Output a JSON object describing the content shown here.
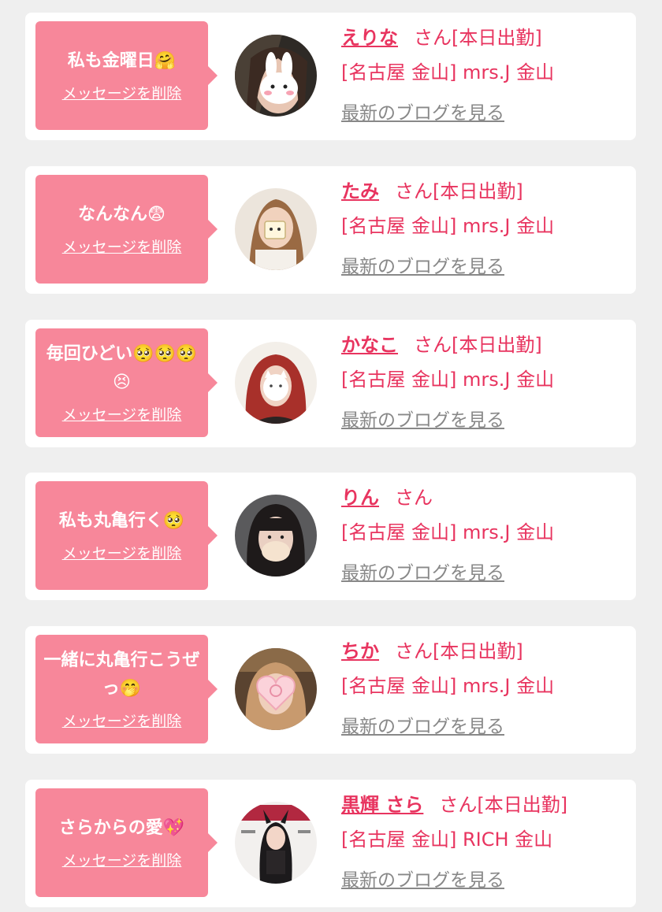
{
  "ui": {
    "delete_label": "メッセージを削除",
    "blog_label": "最新のブログを見る"
  },
  "colors": {
    "page_bg": "#efefef",
    "bubble_pink": "#f7879a",
    "accent_text": "#e8345f",
    "muted_text": "#888888"
  },
  "cards": [
    {
      "message": "私も金曜日🤗",
      "name": "えりな",
      "suffix": "さん[本日出勤]",
      "shop": "[名古屋 金山] mrs.J 金山",
      "avatar_icon": "girl-photo-rabbit-sticker-icon"
    },
    {
      "message": "なんなん😨",
      "name": "たみ",
      "suffix": "さん[本日出勤]",
      "shop": "[名古屋 金山] mrs.J 金山",
      "avatar_icon": "girl-photo-cube-sticker-icon"
    },
    {
      "message": "毎回ひどい🥺🥺🥺😣",
      "name": "かなこ",
      "suffix": "さん[本日出勤]",
      "shop": "[名古屋 金山] mrs.J 金山",
      "avatar_icon": "girl-photo-cat-sticker-icon"
    },
    {
      "message": "私も丸亀行く🥺",
      "name": "りん",
      "suffix": "さん",
      "shop": "[名古屋 金山] mrs.J 金山",
      "avatar_icon": "girl-photo-mask-icon"
    },
    {
      "message": "一緒に丸亀行こうぜっ🤭",
      "name": "ちか",
      "suffix": "さん[本日出勤]",
      "shop": "[名古屋 金山] mrs.J 金山",
      "avatar_icon": "girl-photo-heart-sticker-icon"
    },
    {
      "message": "さらからの愛💖",
      "name": "黒輝 さら",
      "suffix": "さん[本日出勤]",
      "shop": "[名古屋 金山] RICH 金山",
      "avatar_icon": "magazine-cover-photo-icon"
    }
  ]
}
